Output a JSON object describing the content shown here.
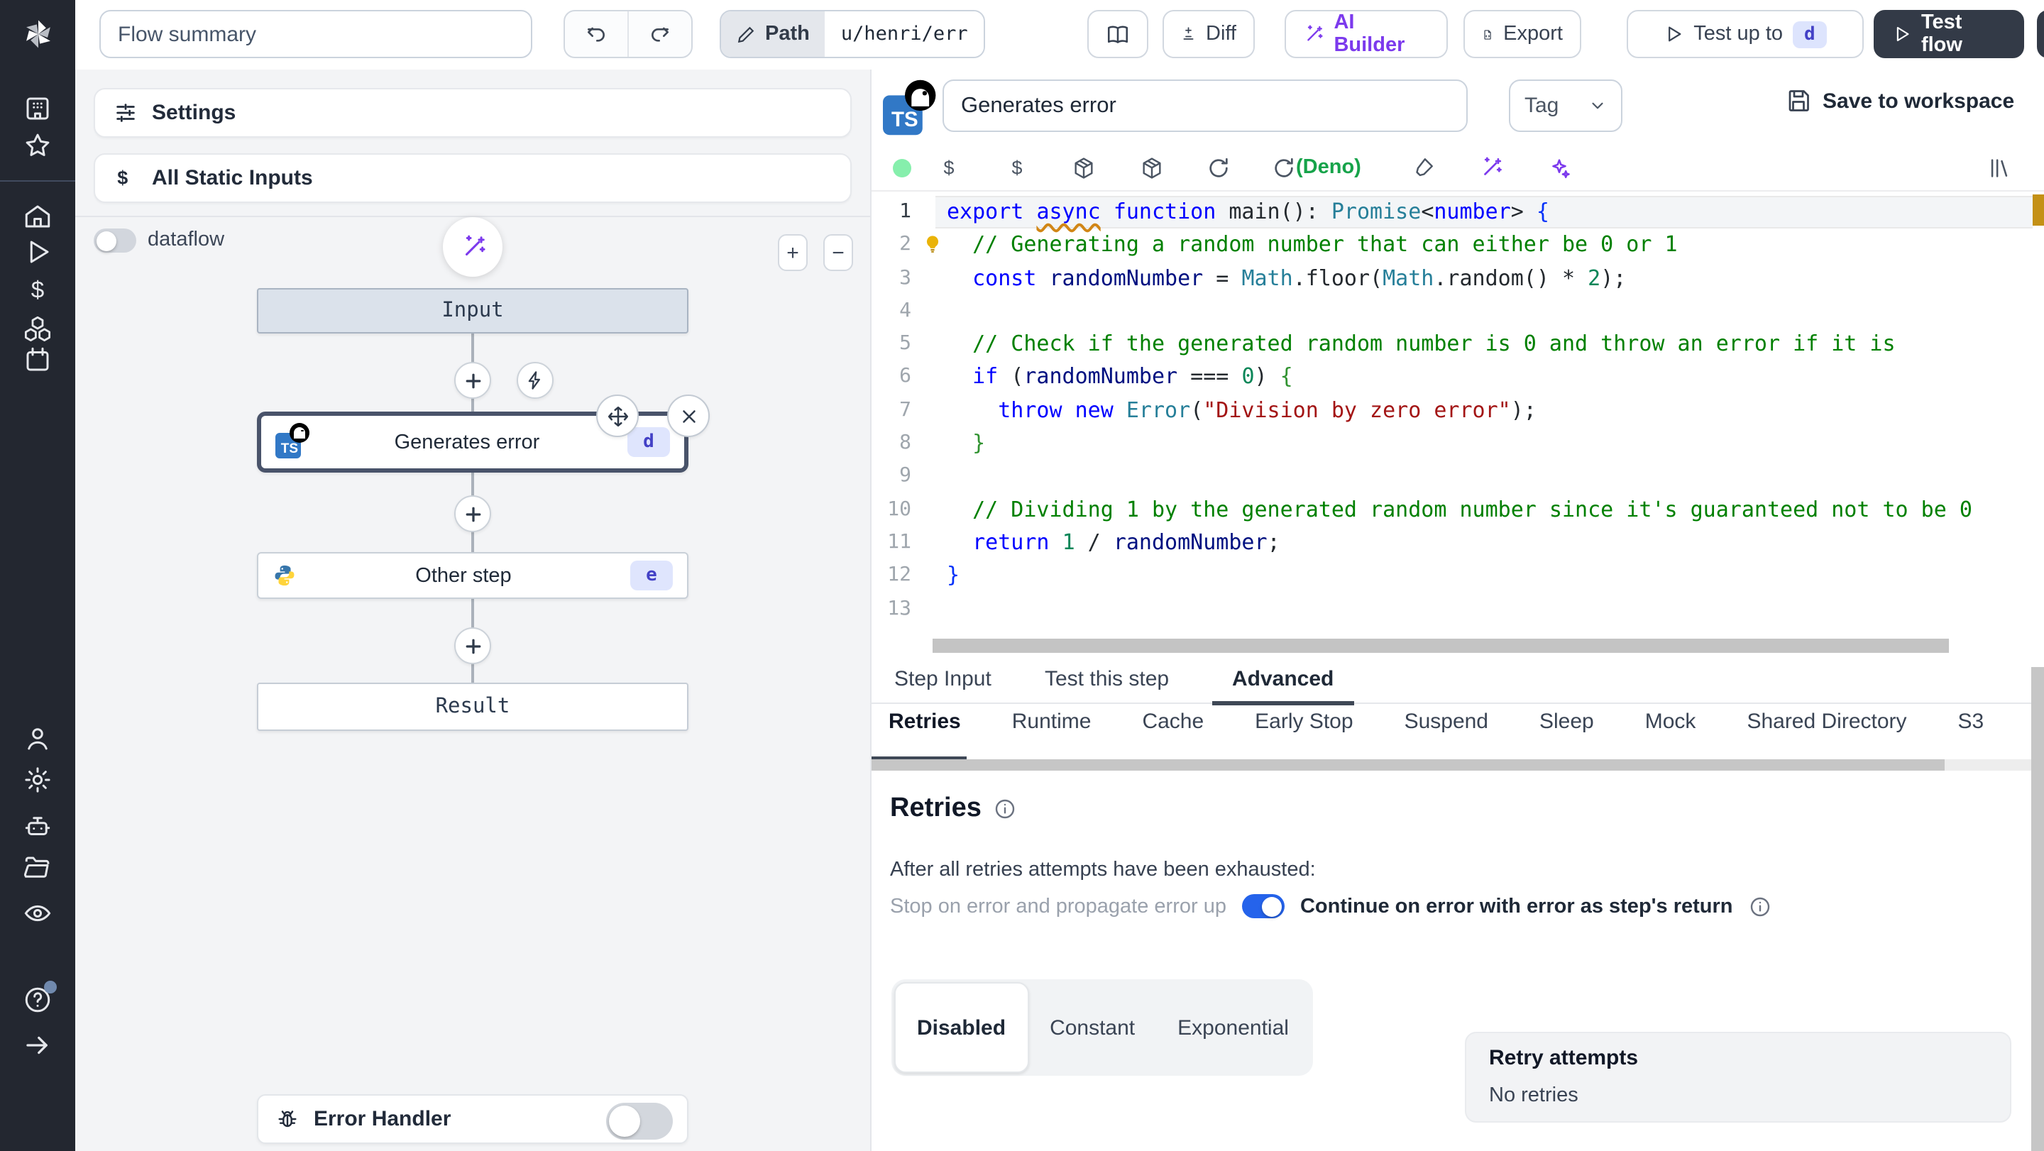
{
  "topbar": {
    "flow_summary": "Flow summary",
    "path_label": "Path",
    "path_value": "u/henri/err",
    "diff_label": "Diff",
    "ai_builder_label": "AI Builder",
    "export_label": "Export",
    "test_up_to_label": "Test up to",
    "test_up_to_badge": "d",
    "test_flow_label": "Test flow"
  },
  "flow": {
    "settings_label": "Settings",
    "static_inputs_label": "All Static Inputs",
    "dataflow_label": "dataflow",
    "input_node": "Input",
    "selected_step": {
      "label": "Generates error",
      "id": "d"
    },
    "other_step": {
      "label": "Other step",
      "id": "e"
    },
    "result_node": "Result",
    "error_handler_label": "Error Handler"
  },
  "step": {
    "language_badge": "TS",
    "name": "Generates error",
    "tag_placeholder": "Tag",
    "save_label": "Save to workspace",
    "runtime_label": "(Deno)"
  },
  "editor": {
    "active_line": 0,
    "lines": [
      [
        [
          "export",
          "kw"
        ],
        [
          " ",
          "d"
        ],
        [
          "async",
          "kw sq"
        ],
        [
          " ",
          "d"
        ],
        [
          "function",
          "kw"
        ],
        [
          " main(): ",
          "d"
        ],
        [
          "Promise",
          "ty"
        ],
        [
          "<",
          "d"
        ],
        [
          "number",
          "kw"
        ],
        [
          "> ",
          "d"
        ],
        [
          "{",
          "bb"
        ]
      ],
      [
        [
          "  ",
          "d"
        ],
        [
          "// Generating a random number that can either be 0 or 1",
          "cm"
        ]
      ],
      [
        [
          "  ",
          "d"
        ],
        [
          "const",
          "kw"
        ],
        [
          " ",
          "d"
        ],
        [
          "randomNumber",
          "vr"
        ],
        [
          " = ",
          "d"
        ],
        [
          "Math",
          "ty"
        ],
        [
          ".floor(",
          "d"
        ],
        [
          "Math",
          "ty"
        ],
        [
          ".random() * ",
          "d"
        ],
        [
          "2",
          "nm"
        ],
        [
          ");",
          "d"
        ]
      ],
      [],
      [
        [
          "  ",
          "d"
        ],
        [
          "// Check if the generated random number is 0 and throw an error if it is",
          "cm"
        ]
      ],
      [
        [
          "  ",
          "d"
        ],
        [
          "if",
          "kw"
        ],
        [
          " (",
          "d"
        ],
        [
          "randomNumber",
          "vr"
        ],
        [
          " === ",
          "d"
        ],
        [
          "0",
          "nm"
        ],
        [
          ") ",
          "d"
        ],
        [
          "{",
          "bg"
        ]
      ],
      [
        [
          "    ",
          "d"
        ],
        [
          "throw",
          "kw"
        ],
        [
          " ",
          "d"
        ],
        [
          "new",
          "kw"
        ],
        [
          " ",
          "d"
        ],
        [
          "Error",
          "ty"
        ],
        [
          "(",
          "d"
        ],
        [
          "\"Division by zero error\"",
          "st"
        ],
        [
          ");",
          "d"
        ]
      ],
      [
        [
          "  ",
          "d"
        ],
        [
          "}",
          "bg"
        ]
      ],
      [],
      [
        [
          "  ",
          "d"
        ],
        [
          "// Dividing 1 by the generated random number since it's guaranteed not to be 0",
          "cm"
        ]
      ],
      [
        [
          "  ",
          "d"
        ],
        [
          "return",
          "kw"
        ],
        [
          " ",
          "d"
        ],
        [
          "1",
          "nm"
        ],
        [
          " / ",
          "d"
        ],
        [
          "randomNumber",
          "vr"
        ],
        [
          ";",
          "d"
        ]
      ],
      [
        [
          "}",
          "bb"
        ]
      ],
      []
    ]
  },
  "panel": {
    "tabs": [
      "Step Input",
      "Test this step",
      "Advanced"
    ],
    "tab_lefts": [
      16,
      122,
      254
    ],
    "active_tab": "Advanced",
    "subtabs": [
      "Retries",
      "Runtime",
      "Cache",
      "Early Stop",
      "Suspend",
      "Sleep",
      "Mock",
      "Shared Directory",
      "S3"
    ],
    "active_subtab": "Retries"
  },
  "retries": {
    "title": "Retries",
    "note": "After all retries attempts have been exhausted:",
    "toggle_left": "Stop on error and propagate error up",
    "toggle_right": "Continue on error with error as step's return",
    "toggle_on": true,
    "modes": [
      "Disabled",
      "Constant",
      "Exponential"
    ],
    "active_mode": "Disabled",
    "summary_title": "Retry attempts",
    "summary_value": "No retries"
  },
  "colors": {
    "accent_purple": "#7c3aed",
    "toggle_on_blue": "#2563eb",
    "badge_bg": "#dfe5fd",
    "badge_text": "#4341c6",
    "deno_green": "#16a34a",
    "sidebar_bg": "#232730",
    "ts_blue": "#3178c6"
  }
}
